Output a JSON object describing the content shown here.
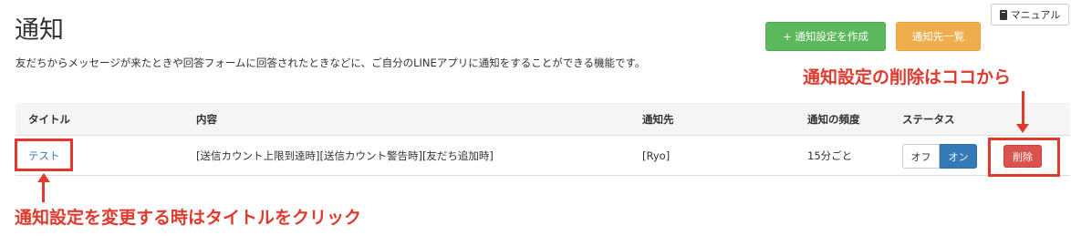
{
  "header": {
    "title": "通知",
    "description": "友だちからメッセージが来たときや回答フォームに回答されたときなどに、ご自分のLINEアプリに通知をすることができる機能です。",
    "manual_label": "マニュアル",
    "manual_icon": "book-icon"
  },
  "toolbar": {
    "create_label": "+ 通知設定を作成",
    "list_label": "通知先一覧",
    "create_color": "#5cb85c",
    "list_color": "#f0ad4e"
  },
  "table": {
    "columns": [
      "タイトル",
      "内容",
      "通知先",
      "通知の頻度",
      "ステータス"
    ],
    "rows": [
      {
        "title": "テスト",
        "content": "[送信カウント上限到達時][送信カウント警告時][友だち追加時]",
        "recipient": "[Ryo]",
        "frequency": "15分ごと",
        "status_off": "オフ",
        "status_on": "オン",
        "status_selected": "オン",
        "delete_label": "削除"
      }
    ]
  },
  "annotations": {
    "delete_hint": "通知設定の削除はココから",
    "title_hint": "通知設定を変更する時はタイトルをクリック",
    "color": "#e03a2f"
  }
}
